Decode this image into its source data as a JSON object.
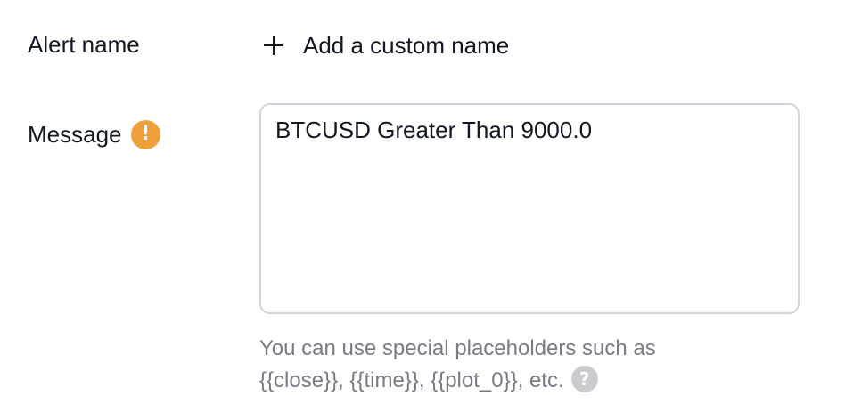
{
  "alert_name": {
    "label": "Alert name",
    "add_label": "Add a custom name",
    "add_icon": "plus-icon"
  },
  "message": {
    "label": "Message",
    "warning_icon": "exclamation-warning-icon",
    "warning_color": "#f0a03a",
    "value": "BTCUSD Greater Than 9000.0"
  },
  "hint": {
    "line1": "You can use special placeholders such as",
    "line2": "{{close}}, {{time}}, {{plot_0}}, etc.",
    "help_icon": "question-help-icon",
    "help_glyph": "?"
  }
}
